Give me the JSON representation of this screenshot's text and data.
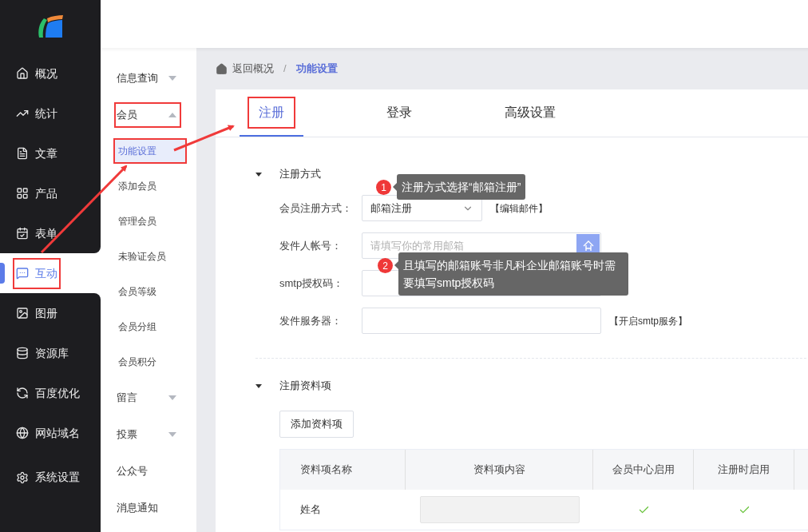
{
  "nav": [
    {
      "label": "概况",
      "selected": false,
      "annotated": false
    },
    {
      "label": "统计",
      "selected": false,
      "annotated": false
    },
    {
      "label": "文章",
      "selected": false,
      "annotated": false
    },
    {
      "label": "产品",
      "selected": false,
      "annotated": false
    },
    {
      "label": "表单",
      "selected": false,
      "annotated": false
    },
    {
      "label": "互动",
      "selected": true,
      "annotated": true
    },
    {
      "label": "图册",
      "selected": false,
      "annotated": false
    },
    {
      "label": "资源库",
      "selected": false,
      "annotated": false
    },
    {
      "label": "百度优化",
      "selected": false,
      "annotated": false
    },
    {
      "label": "网站域名",
      "selected": false,
      "annotated": false
    },
    {
      "label": "系统设置",
      "selected": false,
      "annotated": false
    }
  ],
  "subnav": [
    {
      "label": "信息查询",
      "expanded": false,
      "annotated": false
    },
    {
      "label": "会员",
      "expanded": true,
      "annotated": true,
      "children": [
        {
          "label": "功能设置",
          "selected": true,
          "annotated": true
        },
        {
          "label": "添加会员",
          "selected": false,
          "annotated": false
        },
        {
          "label": "管理会员",
          "selected": false,
          "annotated": false
        },
        {
          "label": "未验证会员",
          "selected": false,
          "annotated": false
        },
        {
          "label": "会员等级",
          "selected": false,
          "annotated": false
        },
        {
          "label": "会员分组",
          "selected": false,
          "annotated": false
        },
        {
          "label": "会员积分",
          "selected": false,
          "annotated": false
        }
      ]
    },
    {
      "label": "留言",
      "expanded": false,
      "annotated": false
    },
    {
      "label": "投票",
      "expanded": false,
      "annotated": false
    },
    {
      "label": "公众号",
      "annotated": false
    },
    {
      "label": "消息通知",
      "annotated": false
    }
  ],
  "breadcrumb": {
    "back": "返回概况",
    "separator": "/",
    "current": "功能设置"
  },
  "tabs": [
    {
      "label": "注册",
      "selected": true,
      "annotated": true
    },
    {
      "label": "登录",
      "selected": false,
      "annotated": false
    },
    {
      "label": "高级设置",
      "selected": false,
      "annotated": false
    }
  ],
  "section_1": {
    "title": "注册方式",
    "expanded": true,
    "fields": [
      {
        "kind": "select",
        "label": "会员注册方式：",
        "value": "邮箱注册",
        "link": "【编辑邮件】"
      },
      {
        "kind": "input_button",
        "label": "发件人帐号：",
        "placeholder": "请填写你的常用邮箱"
      },
      {
        "kind": "input",
        "label": "smtp授权码："
      },
      {
        "kind": "input",
        "label": "发件服务器：",
        "link": "【开启smtp服务】"
      }
    ]
  },
  "section_2": {
    "title": "注册资料项",
    "expanded": true,
    "add_button": "添加资料项",
    "table": {
      "columns": [
        "资料项名称",
        "资料项内容",
        "会员中心启用",
        "注册时启用"
      ],
      "rows": [
        {
          "name": "姓名",
          "member_center": true,
          "on_register": true
        }
      ]
    }
  },
  "callouts": [
    {
      "number": "1",
      "text": "注册方式选择“邮箱注册”"
    },
    {
      "number": "2",
      "text": "且填写的邮箱账号非凡科企业邮箱账号时需要填写smtp授权码"
    }
  ]
}
